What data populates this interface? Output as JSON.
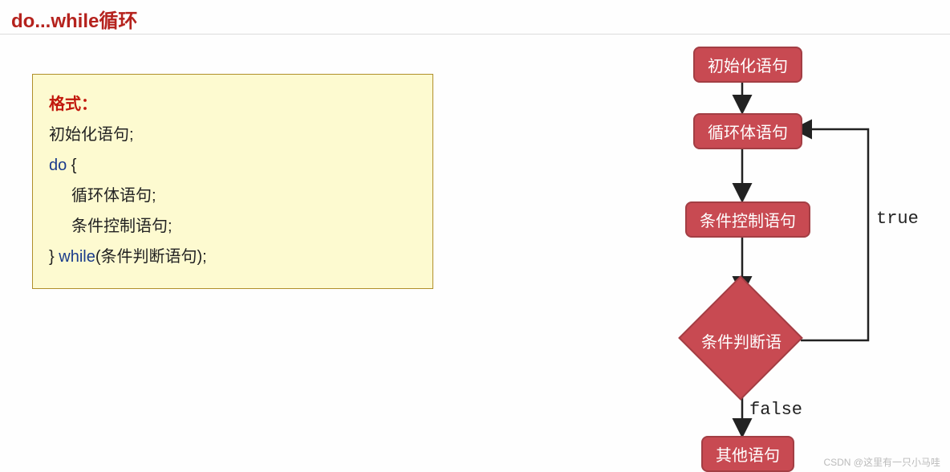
{
  "title": "do...while循环",
  "code": {
    "header": "格式：",
    "line1": "初始化语句;",
    "line2_kw": "do",
    "line2_brace": " {",
    "line3": "循环体语句;",
    "line4": "条件控制语句;",
    "line5_brace": "} ",
    "line5_kw": "while",
    "line5_rest": "(条件判断语句);"
  },
  "flow": {
    "n1": "初始化语句",
    "n2": "循环体语句",
    "n3": "条件控制语句",
    "d4": "条件判断语",
    "n5": "其他语句",
    "true": "true",
    "false": "false"
  },
  "watermark": "CSDN @这里有一只小马哇",
  "chart_data": {
    "type": "flowchart",
    "title": "do...while循环",
    "nodes": [
      {
        "id": "n1",
        "kind": "process",
        "label": "初始化语句"
      },
      {
        "id": "n2",
        "kind": "process",
        "label": "循环体语句"
      },
      {
        "id": "n3",
        "kind": "process",
        "label": "条件控制语句"
      },
      {
        "id": "d4",
        "kind": "decision",
        "label": "条件判断语"
      },
      {
        "id": "n5",
        "kind": "process",
        "label": "其他语句"
      }
    ],
    "edges": [
      {
        "from": "n1",
        "to": "n2",
        "label": ""
      },
      {
        "from": "n2",
        "to": "n3",
        "label": ""
      },
      {
        "from": "n3",
        "to": "d4",
        "label": ""
      },
      {
        "from": "d4",
        "to": "n2",
        "label": "true"
      },
      {
        "from": "d4",
        "to": "n5",
        "label": "false"
      }
    ]
  }
}
